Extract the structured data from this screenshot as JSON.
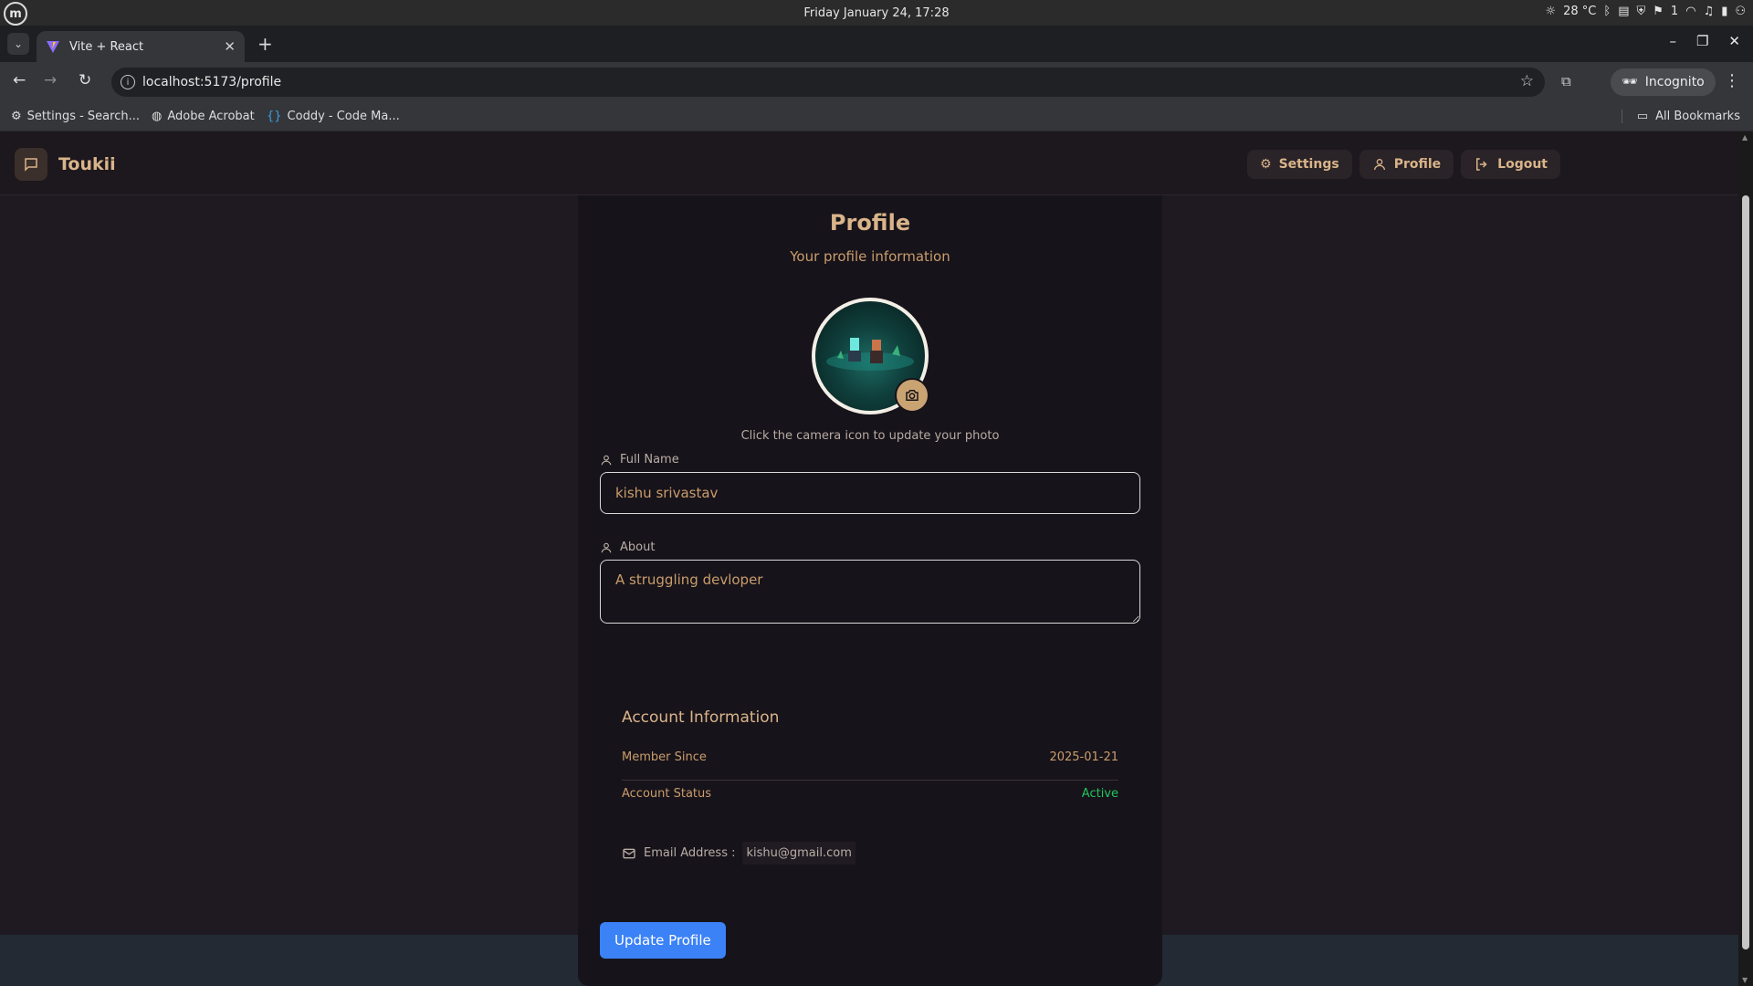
{
  "os": {
    "logo": "m",
    "datetime": "Friday January 24, 17:28",
    "weather": "28 °C",
    "notifications": "1"
  },
  "browser": {
    "tab_title": "Vite + React",
    "url": "localhost:5173/profile",
    "incognito_label": "Incognito",
    "bookmarks": [
      "Settings - Search...",
      "Adobe Acrobat",
      "Coddy - Code Ma..."
    ],
    "all_bookmarks": "All Bookmarks"
  },
  "app": {
    "brand": "Toukii",
    "nav": [
      "Settings",
      "Profile",
      "Logout"
    ]
  },
  "profile": {
    "title": "Profile",
    "subtitle": "Your profile information",
    "photo_hint": "Click the camera icon to update your photo",
    "full_name_label": "Full Name",
    "full_name_value": "kishu srivastav",
    "about_label": "About",
    "about_value": "A struggling devloper",
    "account_title": "Account Information",
    "member_since_label": "Member Since",
    "member_since_value": "2025-01-21",
    "status_label": "Account Status",
    "status_value": "Active",
    "email_label": "Email Address :",
    "email_value": "kishu@gmail.com",
    "update_button": "Update Profile"
  },
  "colors": {
    "accent": "#d9b48a",
    "status_active": "#22c55e",
    "primary_button": "#3b82f6"
  }
}
